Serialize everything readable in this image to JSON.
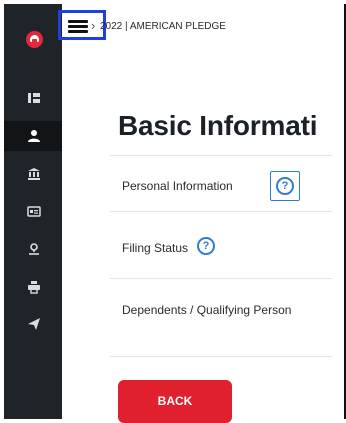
{
  "header": {
    "menu_icon": "hamburger-menu-icon",
    "chevron_icon": "chevron-right-icon",
    "breadcrumb": "2022 | AMERICAN PLEDGE"
  },
  "sidebar": {
    "logo_icon": "brand-logo-icon",
    "items": [
      {
        "icon": "dashboard-icon"
      },
      {
        "icon": "person-icon",
        "active": true
      },
      {
        "icon": "bank-icon"
      },
      {
        "icon": "id-card-icon"
      },
      {
        "icon": "location-pin-icon"
      },
      {
        "icon": "printer-icon"
      },
      {
        "icon": "send-icon"
      }
    ]
  },
  "main": {
    "title": "Basic Informati",
    "sections": [
      {
        "label": "Personal Information",
        "help": "?"
      },
      {
        "label": "Filing Status",
        "help": "?"
      },
      {
        "label": "Dependents / Qualifying Person"
      }
    ],
    "back_label": "BACK"
  },
  "colors": {
    "sidebar_bg": "#1f2428",
    "accent_red": "#e0202e",
    "help_blue": "#2e7bd6",
    "highlight_blue": "#1f3fe0"
  }
}
